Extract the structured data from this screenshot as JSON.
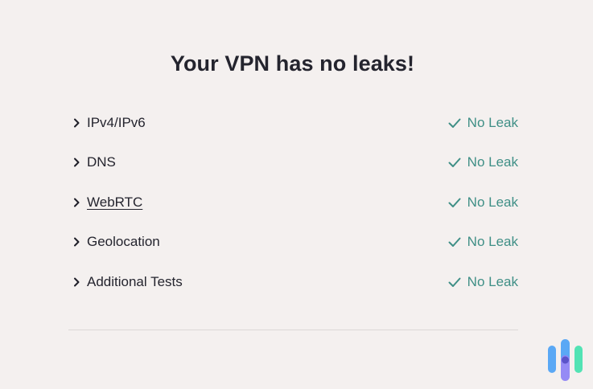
{
  "heading": "Your VPN has no leaks!",
  "tests": [
    {
      "label": "IPv4/IPv6",
      "status": "No Leak",
      "underlined": false
    },
    {
      "label": "DNS",
      "status": "No Leak",
      "underlined": false
    },
    {
      "label": "WebRTC",
      "status": "No Leak",
      "underlined": true
    },
    {
      "label": "Geolocation",
      "status": "No Leak",
      "underlined": false
    },
    {
      "label": "Additional Tests",
      "status": "No Leak",
      "underlined": false
    }
  ],
  "icons": {
    "expand": "chevron-right-icon",
    "status": "check-icon",
    "brand": "brand-logo"
  },
  "colors": {
    "background": "#f4f0ef",
    "text": "#24242e",
    "status_green": "#3f8f86",
    "logo_blue": "#5aa8f5",
    "logo_teal": "#52e3b4",
    "logo_purple": "#8f84f4"
  }
}
